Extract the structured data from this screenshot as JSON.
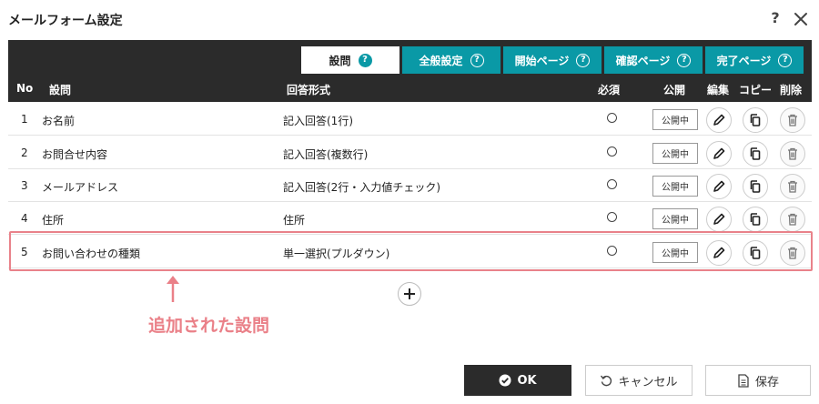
{
  "dialog": {
    "title": "メールフォーム設定",
    "help_label": "?"
  },
  "tabs": [
    {
      "label": "設問",
      "active": true
    },
    {
      "label": "全般設定",
      "active": false
    },
    {
      "label": "開始ページ",
      "active": false
    },
    {
      "label": "確認ページ",
      "active": false
    },
    {
      "label": "完了ページ",
      "active": false
    }
  ],
  "table": {
    "headers": {
      "no": "No",
      "question": "設問",
      "answer_type": "回答形式",
      "required": "必須",
      "public": "公開",
      "edit": "編集",
      "copy": "コピー",
      "delete": "削除"
    },
    "rows": [
      {
        "no": "1",
        "question": "お名前",
        "answer_type": "記入回答(1行)",
        "public": "公開中"
      },
      {
        "no": "2",
        "question": "お問合せ内容",
        "answer_type": "記入回答(複数行)",
        "public": "公開中"
      },
      {
        "no": "3",
        "question": "メールアドレス",
        "answer_type": "記入回答(2行・入力値チェック)",
        "public": "公開中"
      },
      {
        "no": "4",
        "question": "住所",
        "answer_type": "住所",
        "public": "公開中"
      },
      {
        "no": "5",
        "question": "お問い合わせの種類",
        "answer_type": "単一選択(プルダウン)",
        "public": "公開中"
      }
    ]
  },
  "annotation": {
    "text": "追加された設問",
    "color": "#ea8088"
  },
  "buttons": {
    "ok": "OK",
    "cancel": "キャンセル",
    "save": "保存"
  },
  "colors": {
    "teal": "#0a99a6",
    "dark": "#2b2b2b",
    "highlight": "#e9828a"
  }
}
